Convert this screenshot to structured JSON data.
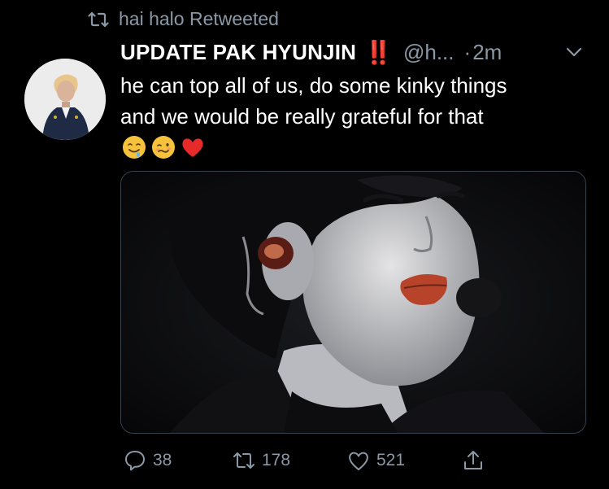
{
  "retweet": {
    "label": "hai halo Retweeted",
    "icon": "retweet-icon"
  },
  "author": {
    "display_name": "UPDATE PAK HYUNJIN",
    "name_emoji": "‼️",
    "handle": "@h...",
    "separator": "·",
    "time": "2m"
  },
  "tweet": {
    "line1": "he can top all of us, do some kinky things",
    "line2": "and we would be really grateful for that",
    "emojis": [
      "drooling-face-emoji",
      "woozy-face-emoji",
      "red-heart-emoji"
    ]
  },
  "actions": {
    "reply_count": "38",
    "retweet_count": "178",
    "like_count": "521"
  },
  "colors": {
    "background": "#000000",
    "muted": "#8b98a5",
    "accent_red": "#e0245e",
    "border": "#38444d"
  }
}
